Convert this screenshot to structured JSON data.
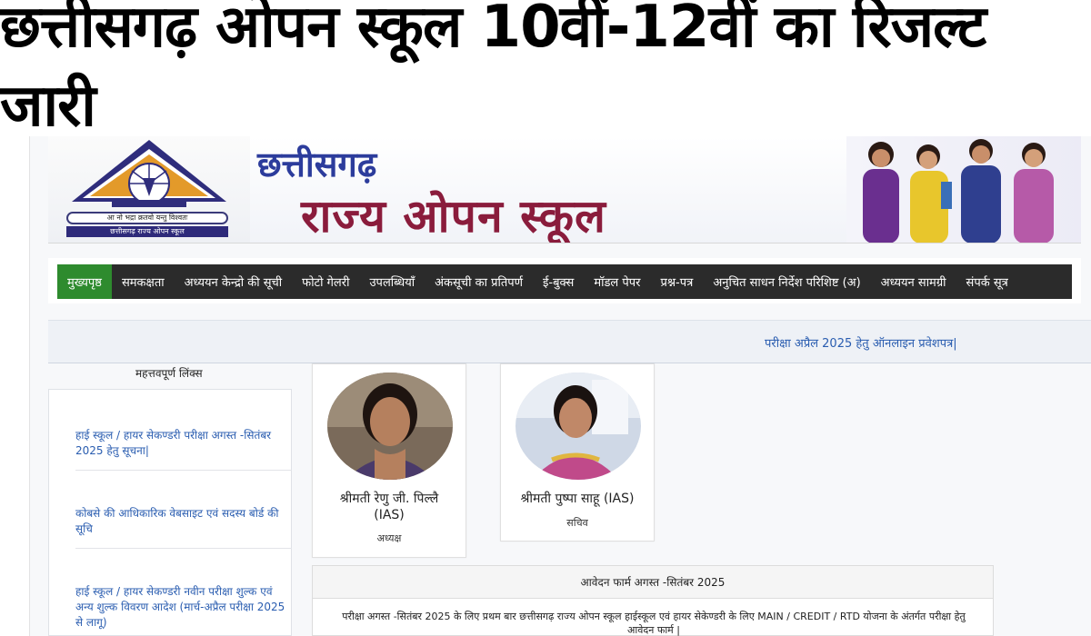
{
  "headline": "छत्तीसगढ़ ओपन स्कूल 10वीं-12वीं का रिजल्ट जारी",
  "banner": {
    "title_line1": "छत्तीसगढ़",
    "title_line2": "राज्य ओपन स्कूल",
    "logo_motto": "आ नो भद्रा क्रतवो यन्तु विश्वतः",
    "logo_name": "छत्तीसगढ़ राज्य ओपन स्कूल"
  },
  "nav": {
    "items": [
      {
        "label": "मुख्यपृष्ठ",
        "active": true
      },
      {
        "label": "समकक्षता"
      },
      {
        "label": "अध्ययन केन्द्रो की सूची"
      },
      {
        "label": "फोटो गेलरी"
      },
      {
        "label": "उपलब्धियाँ"
      },
      {
        "label": "अंकसूची का प्रतिपर्ण"
      },
      {
        "label": "ई-बुक्स"
      },
      {
        "label": "मॉडल पेपर"
      },
      {
        "label": "प्रश्न-पत्र"
      },
      {
        "label": "अनुचित साधन निर्देश परिशिष्ट (अ)"
      },
      {
        "label": "अध्ययन सामग्री"
      },
      {
        "label": "संपर्क सूत्र"
      }
    ]
  },
  "ticker": {
    "text": "परीक्षा अप्रैल 2025 हेतु ऑनलाइन प्रवेशपत्र|"
  },
  "sidebar": {
    "title": "महत्तवपूर्ण लिंक्स",
    "links": [
      "हाई स्कूल / हायर सेकण्डरी परीक्षा अगस्त -सितंबर 2025 हेतु सूचना|",
      "कोबसे की आधिकारिक वेबसाइट एवं सदस्य बोर्ड की सूचि",
      "हाई स्कूल / हायर सेकण्डरी नवीन परीक्षा शुल्क एवं अन्य शुल्क विवरण आदेश (मार्च-अप्रैल परीक्षा 2025 से लागू)"
    ]
  },
  "officials": [
    {
      "name": "श्रीमती रेणु जी. पिल्लै",
      "suffix": "(IAS)",
      "role": "अध्यक्ष"
    },
    {
      "name": "श्रीमती पुष्पा साहू (IAS)",
      "suffix": "",
      "role": "सचिव"
    }
  ],
  "form_panel": {
    "heading": "आवेदन फार्म अगस्त -सितंबर 2025",
    "body": "परीक्षा अगस्त -सितंबर 2025 के लिए प्रथम बार छत्तीसगढ़ राज्य ओपन स्कूल हाईस्कूल एवं हायर सेकेण्डरी के लिए MAIN / CREDIT / RTD योजना के अंतर्गत परीक्षा हेतु आवेदन फार्म |"
  },
  "colors": {
    "nav_bg": "#2b2b2b",
    "nav_active": "#2e8b2e",
    "link": "#2a5db0",
    "banner_blue": "#2c3c9c",
    "banner_maroon": "#8a1c3c"
  }
}
